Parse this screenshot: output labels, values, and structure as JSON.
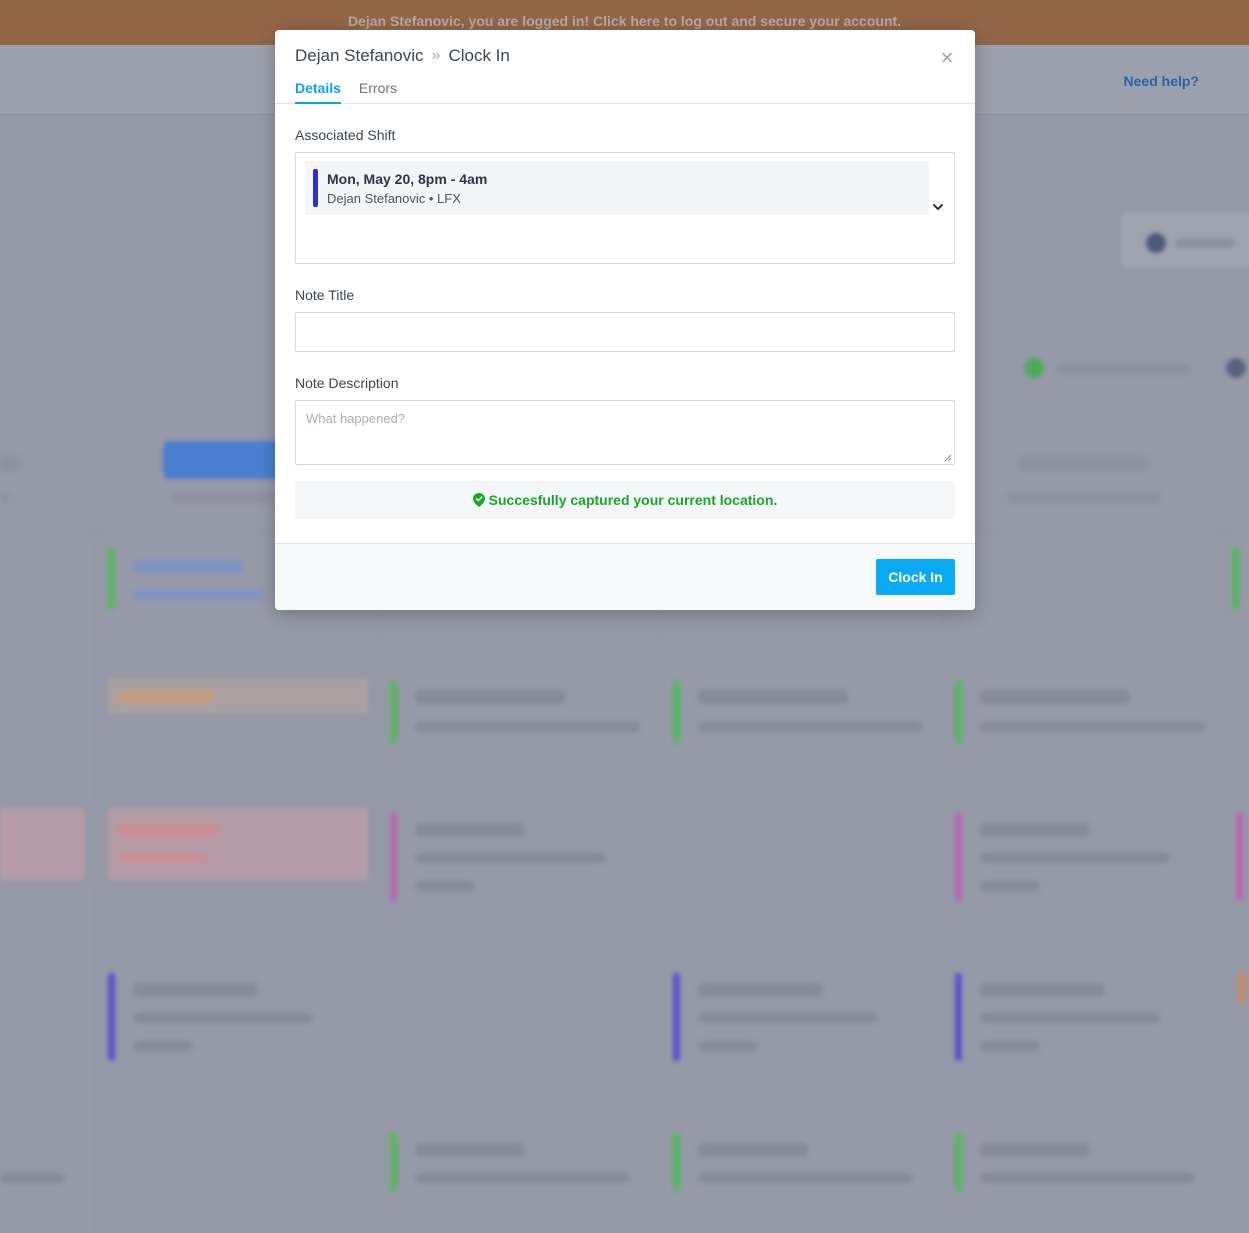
{
  "banner": {
    "text": "Dejan Stefanovic, you are logged in! Click here to log out and secure your account."
  },
  "header": {
    "help_link": "Need help?"
  },
  "modal": {
    "breadcrumb": {
      "parent": "Dejan Stefanovic",
      "separator": "»",
      "current": "Clock In"
    },
    "close_label": "×",
    "tabs": [
      {
        "label": "Details",
        "active": true
      },
      {
        "label": "Errors",
        "active": false
      }
    ],
    "associated_shift": {
      "label": "Associated Shift",
      "time": "Mon, May 20, 8pm - 4am",
      "detail": "Dejan Stefanovic • LFX",
      "accent_color": "#2f2ec7"
    },
    "note_title": {
      "label": "Note Title",
      "value": ""
    },
    "note_description": {
      "label": "Note Description",
      "placeholder": "What happened?",
      "value": ""
    },
    "location_status": {
      "text": "Succesfully captured your current location.",
      "color": "#1aa52b"
    },
    "submit_label": "Clock In"
  },
  "colors": {
    "accent": "#0fa3e0",
    "button": "#0aaaf5",
    "banner": "#93664a",
    "overlay": "#9699a8"
  }
}
